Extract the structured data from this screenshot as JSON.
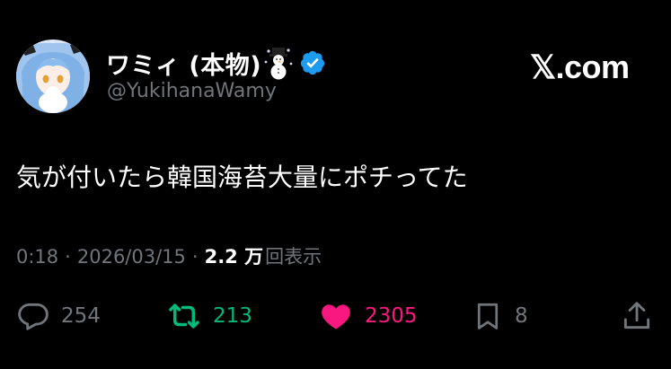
{
  "author": {
    "display_name": "ワミィ (本物)",
    "handle": "@YukihanaWamy",
    "verified": true
  },
  "brand": "𝕏.com",
  "tweet": {
    "text": "気が付いたら韓国海苔大量にポチってた",
    "time": "0:18",
    "separator": "·",
    "date": "2026/03/15",
    "views_count": "2.2 万",
    "views_label": "回表示"
  },
  "actions": {
    "replies": "254",
    "retweets": "213",
    "likes": "2305",
    "bookmarks": "8"
  },
  "colors": {
    "background": "#000000",
    "verified": "#1d9bf0",
    "retweet": "#00ba7c",
    "like": "#f91880",
    "muted": "#71767b"
  },
  "icons": {
    "reply": "reply-icon",
    "retweet": "retweet-icon",
    "like": "heart-icon",
    "bookmark": "bookmark-icon",
    "share": "share-icon",
    "snowman": "snowman-emoji-icon",
    "verified": "verified-badge-icon"
  }
}
